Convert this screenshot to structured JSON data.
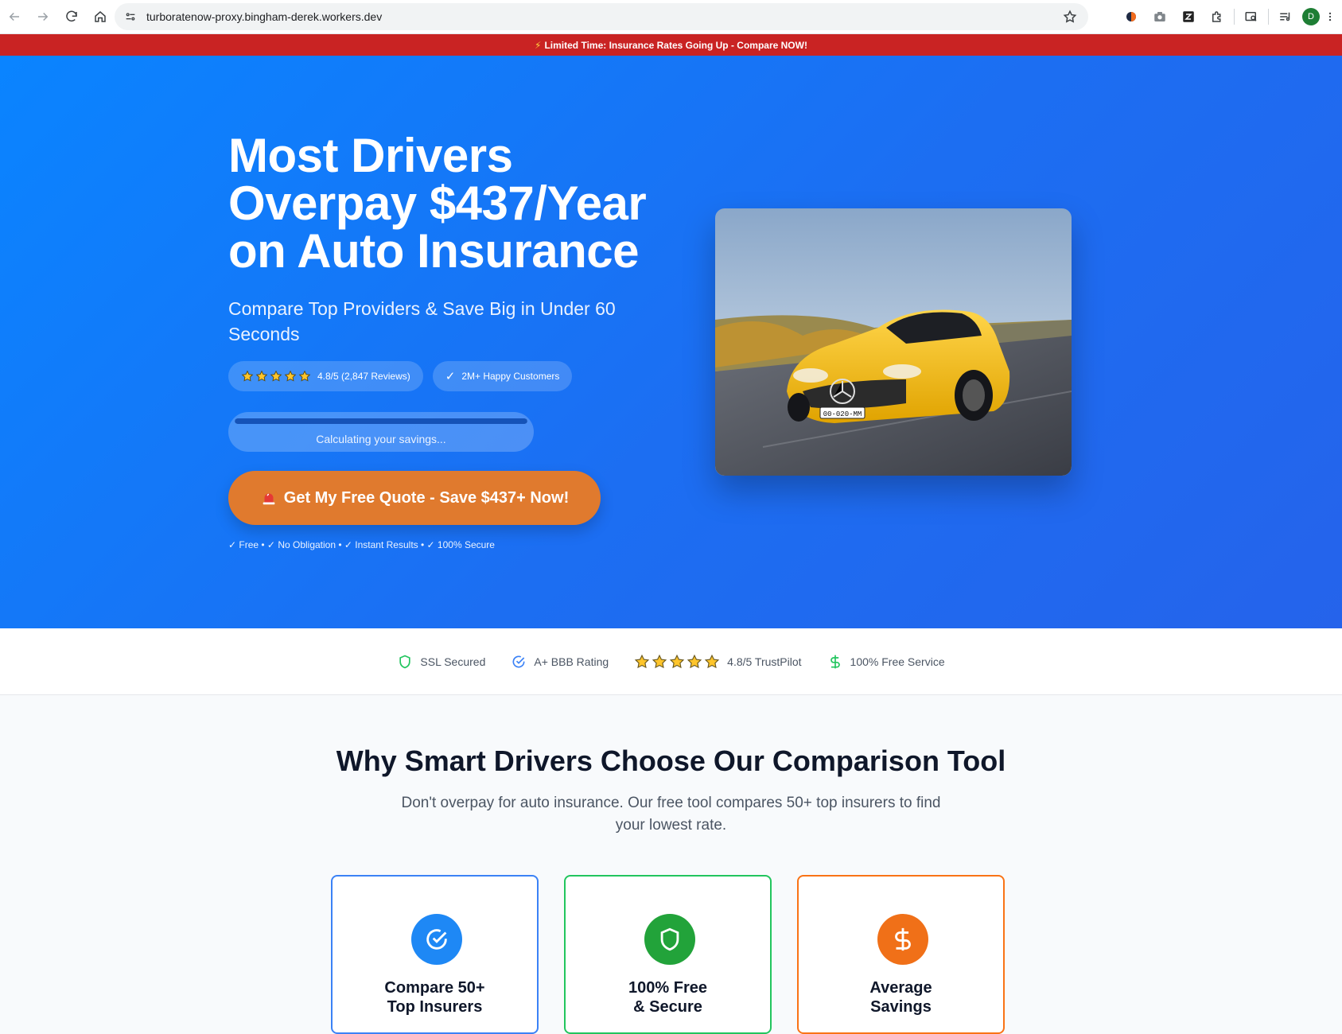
{
  "browser": {
    "url": "turboratenow-proxy.bingham-derek.workers.dev",
    "profile_initial": "D",
    "icons": [
      "back-icon",
      "forward-icon",
      "reload-icon",
      "home-icon",
      "site-settings-icon",
      "bookmark-star-icon",
      "extension-color-icon",
      "camera-icon",
      "zotero-icon",
      "puzzle-icon",
      "search-tab-icon",
      "media-icon"
    ]
  },
  "banner": {
    "icon": "lightning-icon",
    "text": "Limited Time: Insurance Rates Going Up - Compare NOW!"
  },
  "hero": {
    "title": "Most Drivers Overpay $437/Year on Auto Insurance",
    "subtitle": "Compare Top Providers & Save Big in Under 60 Seconds",
    "rating_pill": "4.8/5 (2,847 Reviews)",
    "rating_stars": 5,
    "customers_pill": "2M+ Happy Customers",
    "progress": {
      "label": "Calculating your savings...",
      "fraction": 1.0
    },
    "cta": "Get My Free Quote - Save $437+ Now!",
    "fineprint": "✓ Free • ✓ No Obligation • ✓ Instant Results • ✓ 100% Secure",
    "image_subject": "yellow sports car",
    "plate_text": "00-020-MM"
  },
  "trust": {
    "items": [
      {
        "icon": "shield-icon",
        "label": "SSL Secured"
      },
      {
        "icon": "check-circle-icon",
        "label": "A+ BBB Rating"
      },
      {
        "icon": "stars-icon",
        "label": "4.8/5 TrustPilot"
      },
      {
        "icon": "dollar-icon",
        "label": "100% Free Service"
      }
    ]
  },
  "why": {
    "title": "Why Smart Drivers Choose Our Comparison Tool",
    "subtitle": "Don't overpay for auto insurance. Our free tool compares 50+ top insurers to find your lowest rate.",
    "cards": [
      {
        "title": "Compare 50+ Top Insurers",
        "icon": "check-circle-icon",
        "color": "#1e88f5",
        "border": "#3b82f6"
      },
      {
        "title": "100% Free & Secure",
        "icon": "shield-icon",
        "color": "#22a33a",
        "border": "#22c55e"
      },
      {
        "title": "Average Savings",
        "icon": "dollar-icon",
        "color": "#f07018",
        "border": "#f97316"
      }
    ]
  },
  "colors": {
    "banner": "#c92323",
    "hero": "#0a84ff",
    "cta": "#e07a2e"
  }
}
